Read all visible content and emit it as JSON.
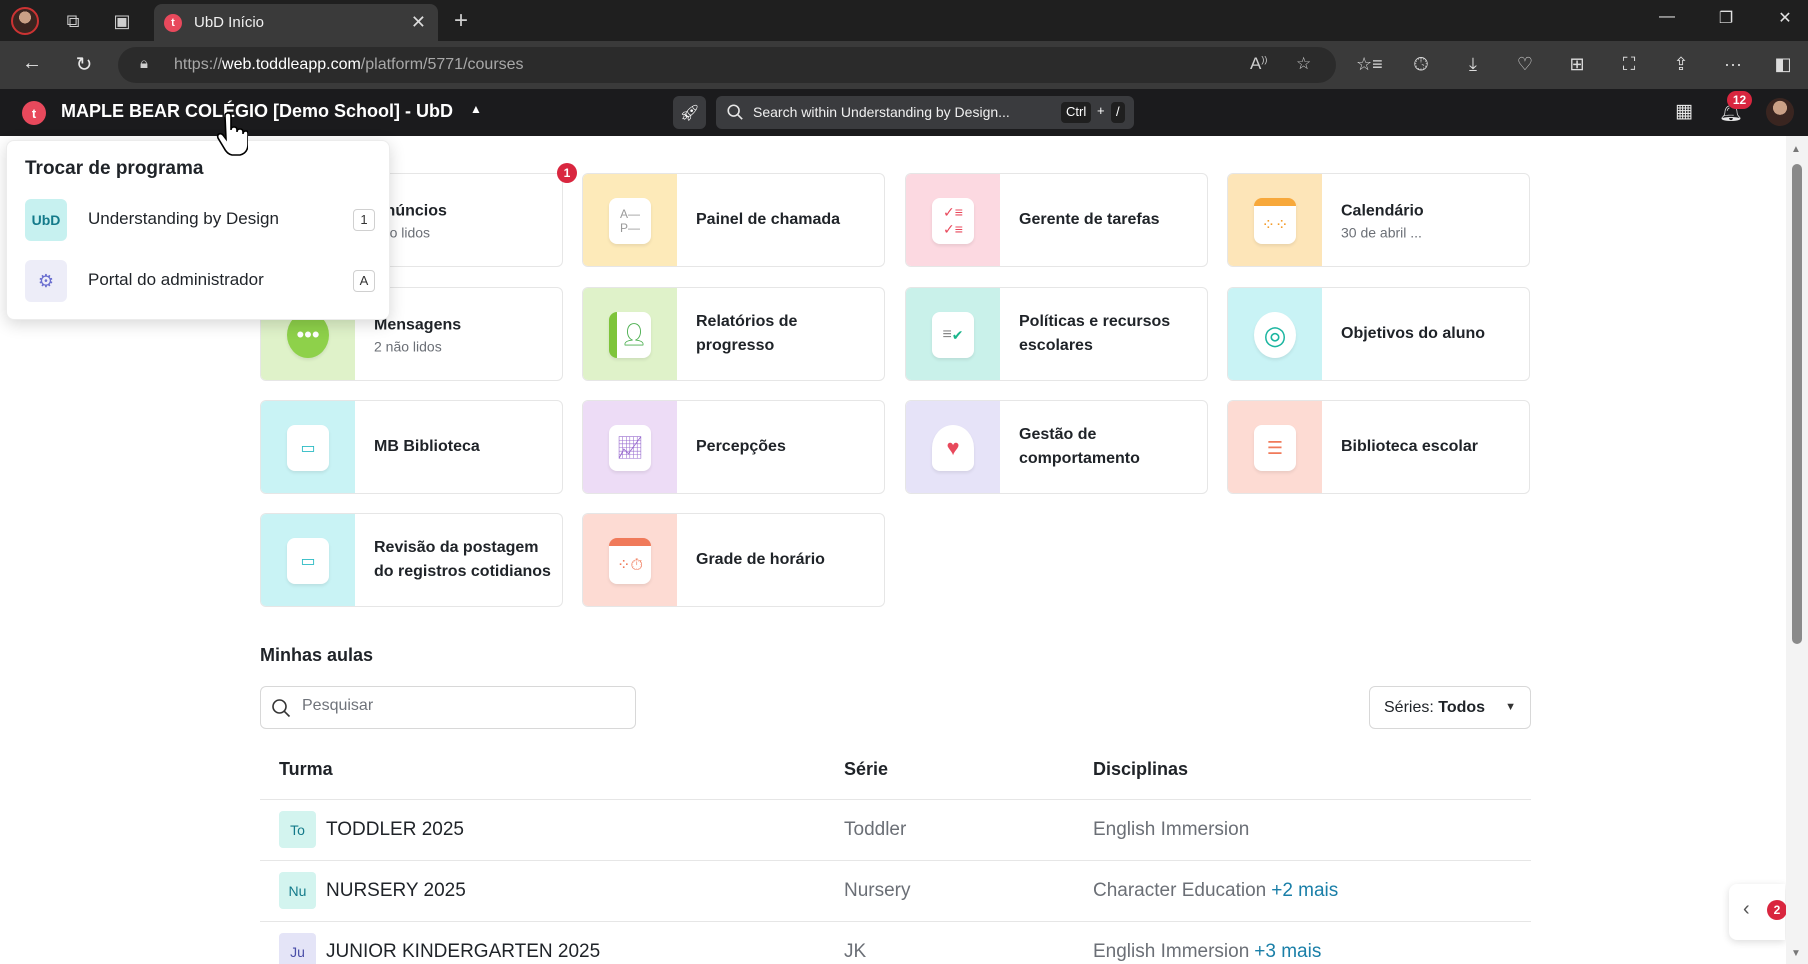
{
  "browser": {
    "tab_title": "UbD Início",
    "tab_favicon_letter": "t",
    "url_prefix": "https://",
    "url_domain": "web.toddleapp.com",
    "url_path": "/platform/5771/courses"
  },
  "header": {
    "logo_letter": "t",
    "school_name": "MAPLE BEAR COLÉGIO [Demo School] - UbD",
    "search_placeholder": "Search within Understanding by Design...",
    "shortcut_key1": "Ctrl",
    "shortcut_plus": "+",
    "shortcut_key2": "/",
    "notification_count": "12"
  },
  "program_switcher": {
    "title": "Trocar de programa",
    "items": [
      {
        "icon_text": "UbD",
        "label": "Understanding by Design",
        "key": "1"
      },
      {
        "icon_text": "",
        "label": "Portal do administrador",
        "key": "A"
      }
    ]
  },
  "tiles": [
    {
      "title": "Anúncios",
      "title_visible": "núncios",
      "subtitle": "não lidos",
      "badge": "1"
    },
    {
      "title": "Painel de chamada",
      "subtitle": ""
    },
    {
      "title": "Gerente de tarefas",
      "subtitle": ""
    },
    {
      "title": "Calendário",
      "subtitle": "30 de abril ..."
    },
    {
      "title": "Mensagens",
      "subtitle": "2 não lidos"
    },
    {
      "title": "Relatórios de progresso",
      "subtitle": ""
    },
    {
      "title": "Políticas e recursos escolares",
      "subtitle": ""
    },
    {
      "title": "Objetivos do aluno",
      "subtitle": ""
    },
    {
      "title": "MB Biblioteca",
      "subtitle": ""
    },
    {
      "title": "Percepções",
      "subtitle": ""
    },
    {
      "title": "Gestão de comportamento",
      "subtitle": ""
    },
    {
      "title": "Biblioteca escolar",
      "subtitle": ""
    },
    {
      "title": "Revisão da postagem do registros cotidianos",
      "subtitle": ""
    },
    {
      "title": "Grade de horário",
      "subtitle": ""
    }
  ],
  "classes": {
    "section_title": "Minhas aulas",
    "search_placeholder": "Pesquisar",
    "filter_label": "Séries:",
    "filter_value": "Todos",
    "columns": [
      "Turma",
      "Série",
      "Disciplinas"
    ],
    "rows": [
      {
        "abbr": "To",
        "name": "TODDLER 2025",
        "serie": "Toddler",
        "disciplines": "English Immersion",
        "more": ""
      },
      {
        "abbr": "Nu",
        "name": "NURSERY 2025",
        "serie": "Nursery",
        "disciplines": "Character Education",
        "more": "+2 mais"
      },
      {
        "abbr": "Ju",
        "name": "JUNIOR KINDERGARTEN 2025",
        "serie": "JK",
        "disciplines": "English Immersion",
        "more": "+3 mais"
      }
    ]
  },
  "floating": {
    "badge": "2"
  },
  "colors": {
    "brand": "#e8495c",
    "badge_red": "#d9263f",
    "link": "#1a7fa8"
  }
}
